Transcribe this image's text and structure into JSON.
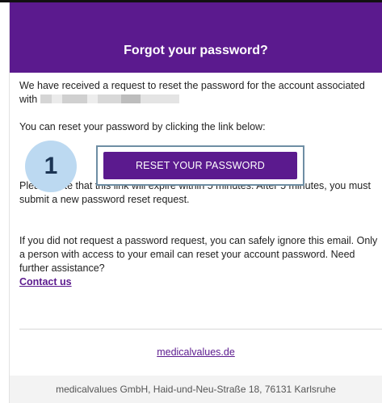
{
  "email": {
    "header": {
      "title": "Forgot your password?",
      "background_color": "#5b1a8e"
    },
    "body": {
      "request_text": "We have received a request to reset the password for the account associated with",
      "instruction_text": "You can reset your password by clicking the link below:",
      "step_badge": "1",
      "reset_button_label": "RESET YOUR PASSWORD",
      "expiry_text": "Please note that this link will expire within 5 minutes. After 5 minutes, you must submit a new password reset request.",
      "ignore_text": "If you did not request a password request, you can safely ignore this email. Only a person with access to your email can reset your account password. Need further assistance?",
      "contact_link": "Contact us"
    },
    "site_link": "medicalvalues.de",
    "footer": {
      "address": "medicalvalues GmbH, Haid-und-Neu-Straße 18, 76131 Karlsruhe"
    },
    "colors": {
      "brand_purple": "#5b1a8e",
      "badge_blue": "#bcd9f1",
      "highlight_border": "#6e8ea4"
    }
  }
}
